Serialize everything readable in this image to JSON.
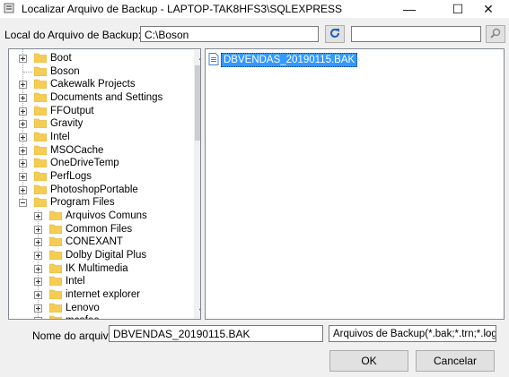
{
  "window": {
    "title": "Localizar Arquivo de Backup - LAPTOP-TAK8HFS3\\SQLEXPRESS",
    "minimize_glyph": "—",
    "maximize_glyph": "☐",
    "close_glyph": "✕"
  },
  "location": {
    "label": "Local do Arquivo de Backup:",
    "value": "C:\\Boson",
    "refresh_icon": "refresh-icon",
    "search_value": "",
    "search_icon": "search-icon"
  },
  "tree": {
    "items": [
      {
        "label": "Boot"
      },
      {
        "label": "Boson"
      },
      {
        "label": "Cakewalk Projects"
      },
      {
        "label": "Documents and Settings"
      },
      {
        "label": "FFOutput"
      },
      {
        "label": "Gravity"
      },
      {
        "label": "Intel"
      },
      {
        "label": "MSOCache"
      },
      {
        "label": "OneDriveTemp"
      },
      {
        "label": "PerfLogs"
      },
      {
        "label": "PhotoshopPortable"
      },
      {
        "label": "Program Files"
      },
      {
        "label": "Arquivos Comuns"
      },
      {
        "label": "Common Files"
      },
      {
        "label": "CONEXANT"
      },
      {
        "label": "Dolby Digital Plus"
      },
      {
        "label": "IK Multimedia"
      },
      {
        "label": "Intel"
      },
      {
        "label": "internet explorer"
      },
      {
        "label": "Lenovo"
      },
      {
        "label": "mcafee"
      }
    ],
    "scroll_up": "▲",
    "scroll_down": "▼"
  },
  "files": {
    "items": [
      {
        "name": "DBVENDAS_20190115.BAK",
        "selected": true
      }
    ]
  },
  "footer": {
    "filename_label": "Nome do arquivo:",
    "filename_value": "DBVENDAS_20190115.BAK",
    "filter_value": "Arquivos de Backup(*.bak;*.trn;*.log)",
    "filter_arrow": "⌵",
    "ok_label": "OK",
    "cancel_label": "Cancelar"
  },
  "colors": {
    "folder": "#f5cd55",
    "selection": "#3399ff"
  }
}
